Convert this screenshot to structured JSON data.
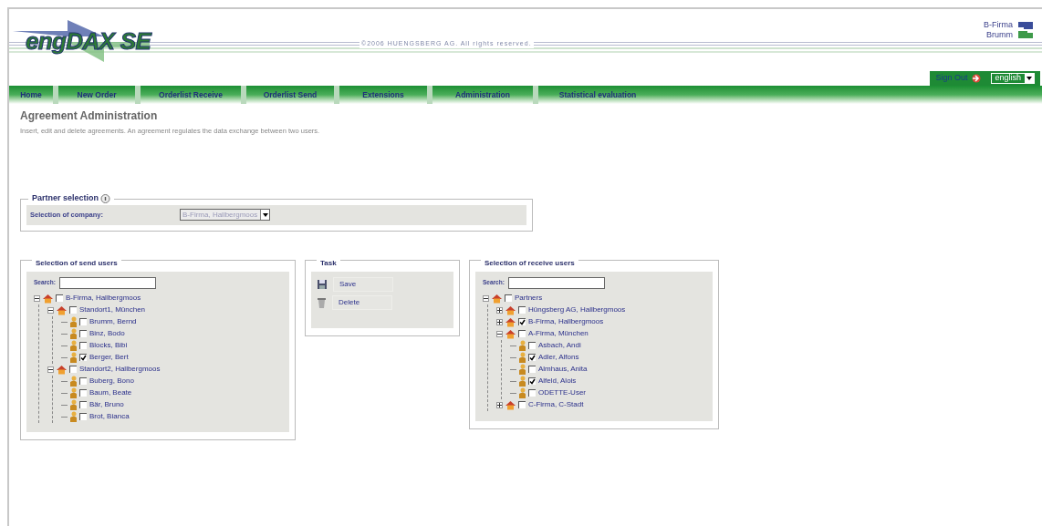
{
  "header": {
    "logo": "engDAX SE",
    "copyright": "©2006 HUENGSBERG AG. All rights reserved.",
    "user_lines": [
      "B-Firma",
      "Brumm"
    ]
  },
  "toolbar": {
    "sign_out": "Sign Out",
    "language": "english"
  },
  "nav": [
    {
      "label": "Home"
    },
    {
      "label": "New Order"
    },
    {
      "label": "Orderlist Receive"
    },
    {
      "label": "Orderlist Send"
    },
    {
      "label": "Extensions"
    },
    {
      "label": "Administration"
    },
    {
      "label": "Statistical evaluation"
    }
  ],
  "page": {
    "title": "Agreement Administration",
    "subtitle": "Insert, edit and delete agreements. An agreement regulates the data exchange between two users."
  },
  "partner_selection": {
    "legend": "Partner selection",
    "field_label": "Selection of company:",
    "value": "B-Firma, Hallbergmoos",
    "disabled": true
  },
  "send_users": {
    "legend": "Selection of send users",
    "search_label": "Search:",
    "tree": [
      {
        "kind": "group",
        "label": "B-Firma, Hallbergmoos",
        "checked": false,
        "expanded": true,
        "children": [
          {
            "kind": "group",
            "label": "Standort1, München",
            "checked": false,
            "expanded": true,
            "children": [
              {
                "kind": "user",
                "label": "Brumm, Bernd",
                "checked": false
              },
              {
                "kind": "user",
                "label": "Binz, Bodo",
                "checked": false
              },
              {
                "kind": "user",
                "label": "Blocks, Bibi",
                "checked": false
              },
              {
                "kind": "user",
                "label": "Berger, Bert",
                "checked": true
              }
            ]
          },
          {
            "kind": "group",
            "label": "Standort2, Hallbergmoos",
            "checked": false,
            "expanded": true,
            "children": [
              {
                "kind": "user",
                "label": "Buberg, Bono",
                "checked": false
              },
              {
                "kind": "user",
                "label": "Baum, Beate",
                "checked": false
              },
              {
                "kind": "user",
                "label": "Bär, Bruno",
                "checked": false
              },
              {
                "kind": "user",
                "label": "Brot, Bianca",
                "checked": false
              }
            ]
          }
        ]
      }
    ]
  },
  "task": {
    "legend": "Task",
    "buttons": [
      {
        "kind": "save",
        "label": "Save"
      },
      {
        "kind": "delete",
        "label": "Delete"
      }
    ]
  },
  "receive_users": {
    "legend": "Selection of receive users",
    "search_label": "Search:",
    "tree": [
      {
        "kind": "group",
        "label": "Partners",
        "checked": false,
        "expanded": true,
        "children": [
          {
            "kind": "group",
            "label": "Hüngsberg AG, Hallbergmoos",
            "checked": false,
            "expanded": false
          },
          {
            "kind": "group",
            "label": "B-Firma, Hallbergmoos",
            "checked": true,
            "expanded": false
          },
          {
            "kind": "group",
            "label": "A-Firma, München",
            "checked": false,
            "expanded": true,
            "children": [
              {
                "kind": "user",
                "label": "Asbach, Andi",
                "checked": false
              },
              {
                "kind": "user",
                "label": "Adler, Alfons",
                "checked": true
              },
              {
                "kind": "user",
                "label": "Almhaus, Anita",
                "checked": false
              },
              {
                "kind": "user",
                "label": "Alfeld, Alois",
                "checked": true
              },
              {
                "kind": "user",
                "label": "ODETTE-User",
                "checked": false
              }
            ]
          },
          {
            "kind": "group",
            "label": "C-Firma, C-Stadt",
            "checked": false,
            "expanded": false
          }
        ]
      }
    ]
  }
}
